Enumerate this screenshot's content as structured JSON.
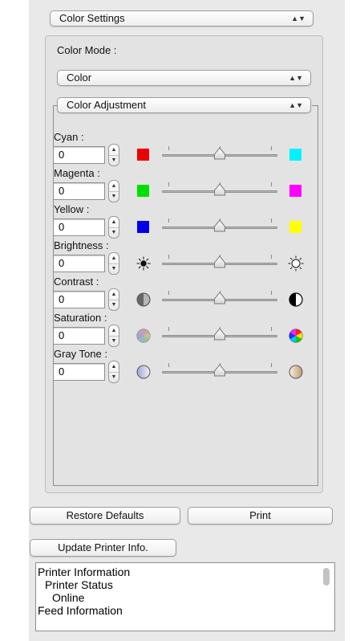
{
  "settings_menu": {
    "value": "Color Settings"
  },
  "color_mode": {
    "label": "Color Mode :",
    "value": "Color"
  },
  "adjustment_menu": {
    "value": "Color Adjustment"
  },
  "sliders": [
    {
      "label": "Cyan :",
      "value": "0",
      "level": 0.5,
      "left_icon": "red-square-icon",
      "right_icon": "cyan-square-icon",
      "left_color": "#ee0000",
      "right_color": "#00f2ff"
    },
    {
      "label": "Magenta :",
      "value": "0",
      "level": 0.5,
      "left_icon": "green-square-icon",
      "right_icon": "magenta-square-icon",
      "left_color": "#00e000",
      "right_color": "#ff00ff"
    },
    {
      "label": "Yellow :",
      "value": "0",
      "level": 0.5,
      "left_icon": "blue-square-icon",
      "right_icon": "yellow-square-icon",
      "left_color": "#0000ee",
      "right_color": "#ffff00"
    },
    {
      "label": "Brightness :",
      "value": "0",
      "level": 0.5,
      "left_icon": "dim-sun-icon",
      "right_icon": "bright-sun-icon"
    },
    {
      "label": "Contrast :",
      "value": "0",
      "level": 0.5,
      "left_icon": "low-contrast-icon",
      "right_icon": "high-contrast-icon"
    },
    {
      "label": "Saturation :",
      "value": "0",
      "level": 0.5,
      "left_icon": "low-saturation-icon",
      "right_icon": "high-saturation-icon"
    },
    {
      "label": "Gray Tone :",
      "value": "0",
      "level": 0.5,
      "left_icon": "cool-gray-icon",
      "right_icon": "warm-gray-icon"
    }
  ],
  "buttons": {
    "restore": "Restore Defaults",
    "print": "Print",
    "update": "Update Printer Info."
  },
  "printer_info": [
    {
      "text": "Printer Information",
      "indent": 0
    },
    {
      "text": "Printer Status",
      "indent": 1
    },
    {
      "text": "Online",
      "indent": 2
    },
    {
      "text": "Feed Information",
      "indent": 0
    }
  ]
}
